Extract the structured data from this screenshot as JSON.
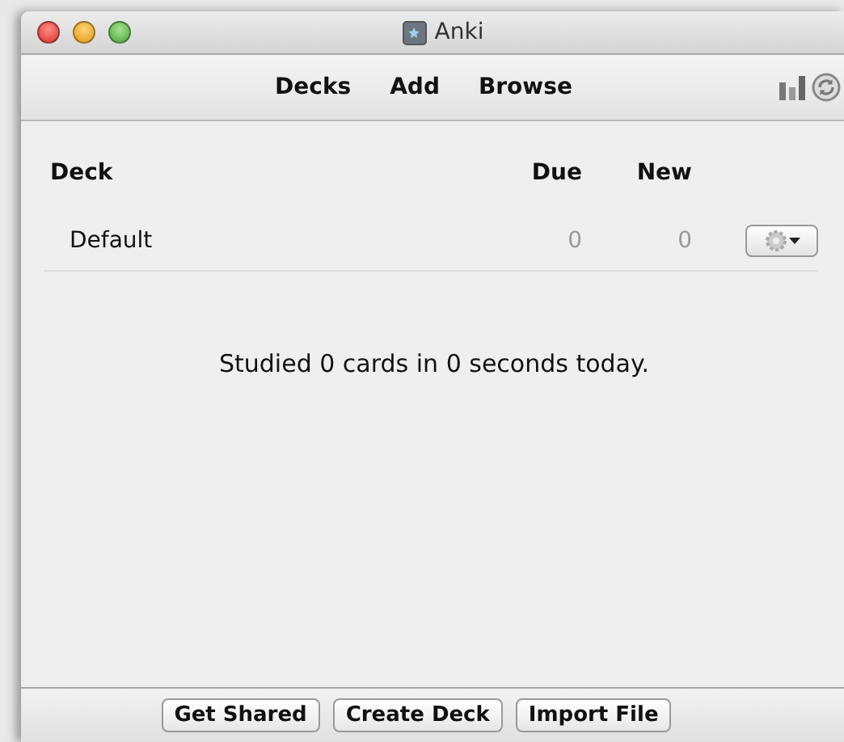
{
  "window": {
    "title": "Anki"
  },
  "toolbar": {
    "links": [
      "Decks",
      "Add",
      "Browse"
    ]
  },
  "table": {
    "columns": [
      "Deck",
      "Due",
      "New"
    ],
    "rows": [
      {
        "deck": "Default",
        "due": "0",
        "new": "0"
      }
    ]
  },
  "summary": "Studied 0 cards in 0 seconds today.",
  "buttons": [
    "Get Shared",
    "Create Deck",
    "Import File"
  ]
}
